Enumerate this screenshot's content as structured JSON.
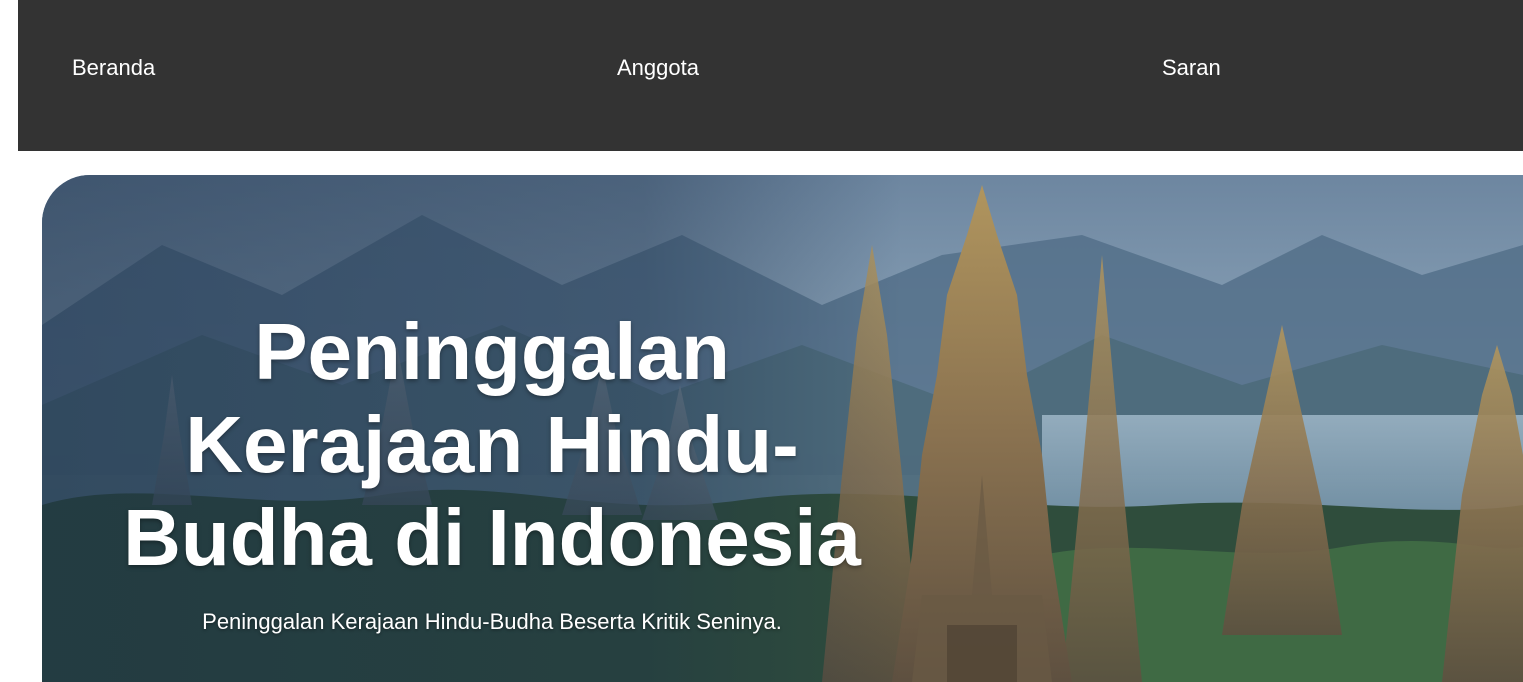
{
  "nav": {
    "items": [
      {
        "label": "Beranda"
      },
      {
        "label": "Anggota"
      },
      {
        "label": "Saran"
      }
    ]
  },
  "hero": {
    "title": "Peninggalan\nKerajaan Hindu-\nBudha di Indonesia",
    "subtitle": "Peninggalan Kerajaan Hindu-Budha Beserta Kritik Seninya.",
    "image": "temple-landscape-image"
  },
  "colors": {
    "navbar_bg": "#333333",
    "nav_text": "#ffffff",
    "hero_text": "#ffffff"
  }
}
